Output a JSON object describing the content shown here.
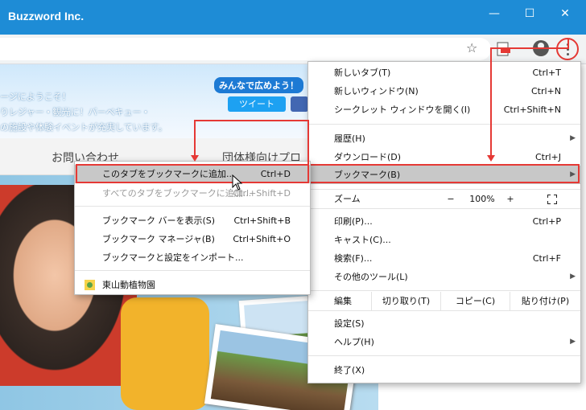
{
  "window": {
    "title": "Buzzword Inc.",
    "minimize": "—",
    "maximize": "☐",
    "close": "✕"
  },
  "toolbar": {
    "bookmark_star": "☆",
    "extension_icon": "pdf-icon",
    "profile_icon": "account-icon",
    "menu_icon": "more-vert-icon"
  },
  "banner": {
    "line1": "ージにようこそ！",
    "line2": "りレジャー・観光に！バーベキュー・",
    "line3": "の施設や体験イベントが充実しています。",
    "share_label": "みんなで広めよう！",
    "tweet_label": "ツイート"
  },
  "nav": {
    "item1": "お問い合わせ",
    "item2": "団体様向けプロ"
  },
  "main_menu": {
    "new_tab": {
      "label": "新しいタブ(T)",
      "shortcut": "Ctrl+T"
    },
    "new_window": {
      "label": "新しいウィンドウ(N)",
      "shortcut": "Ctrl+N"
    },
    "incognito": {
      "label": "シークレット ウィンドウを開く(I)",
      "shortcut": "Ctrl+Shift+N"
    },
    "history": {
      "label": "履歴(H)"
    },
    "downloads": {
      "label": "ダウンロード(D)",
      "shortcut": "Ctrl+J"
    },
    "bookmarks": {
      "label": "ブックマーク(B)"
    },
    "zoom": {
      "label": "ズーム",
      "minus": "−",
      "value": "100%",
      "plus": "+"
    },
    "print": {
      "label": "印刷(P)...",
      "shortcut": "Ctrl+P"
    },
    "cast": {
      "label": "キャスト(C)..."
    },
    "find": {
      "label": "検索(F)...",
      "shortcut": "Ctrl+F"
    },
    "more_tools": {
      "label": "その他のツール(L)"
    },
    "edit": {
      "label": "編集",
      "cut": "切り取り(T)",
      "copy": "コピー(C)",
      "paste": "貼り付け(P)"
    },
    "settings": {
      "label": "設定(S)"
    },
    "help": {
      "label": "ヘルプ(H)"
    },
    "exit": {
      "label": "終了(X)"
    }
  },
  "bookmark_menu": {
    "add_tab": {
      "label": "このタブをブックマークに追加...",
      "shortcut": "Ctrl+D"
    },
    "add_all": {
      "label": "すべてのタブをブックマークに追加...",
      "shortcut": "Ctrl+Shift+D"
    },
    "show_bar": {
      "label": "ブックマーク バーを表示(S)",
      "shortcut": "Ctrl+Shift+B"
    },
    "manager": {
      "label": "ブックマーク マネージャ(B)",
      "shortcut": "Ctrl+Shift+O"
    },
    "import": {
      "label": "ブックマークと設定をインポート..."
    },
    "item1": {
      "label": "東山動植物園"
    }
  },
  "colors": {
    "titlebar": "#1e8cd6",
    "highlight": "#c8c8c8",
    "annotation_red": "#e53935"
  }
}
